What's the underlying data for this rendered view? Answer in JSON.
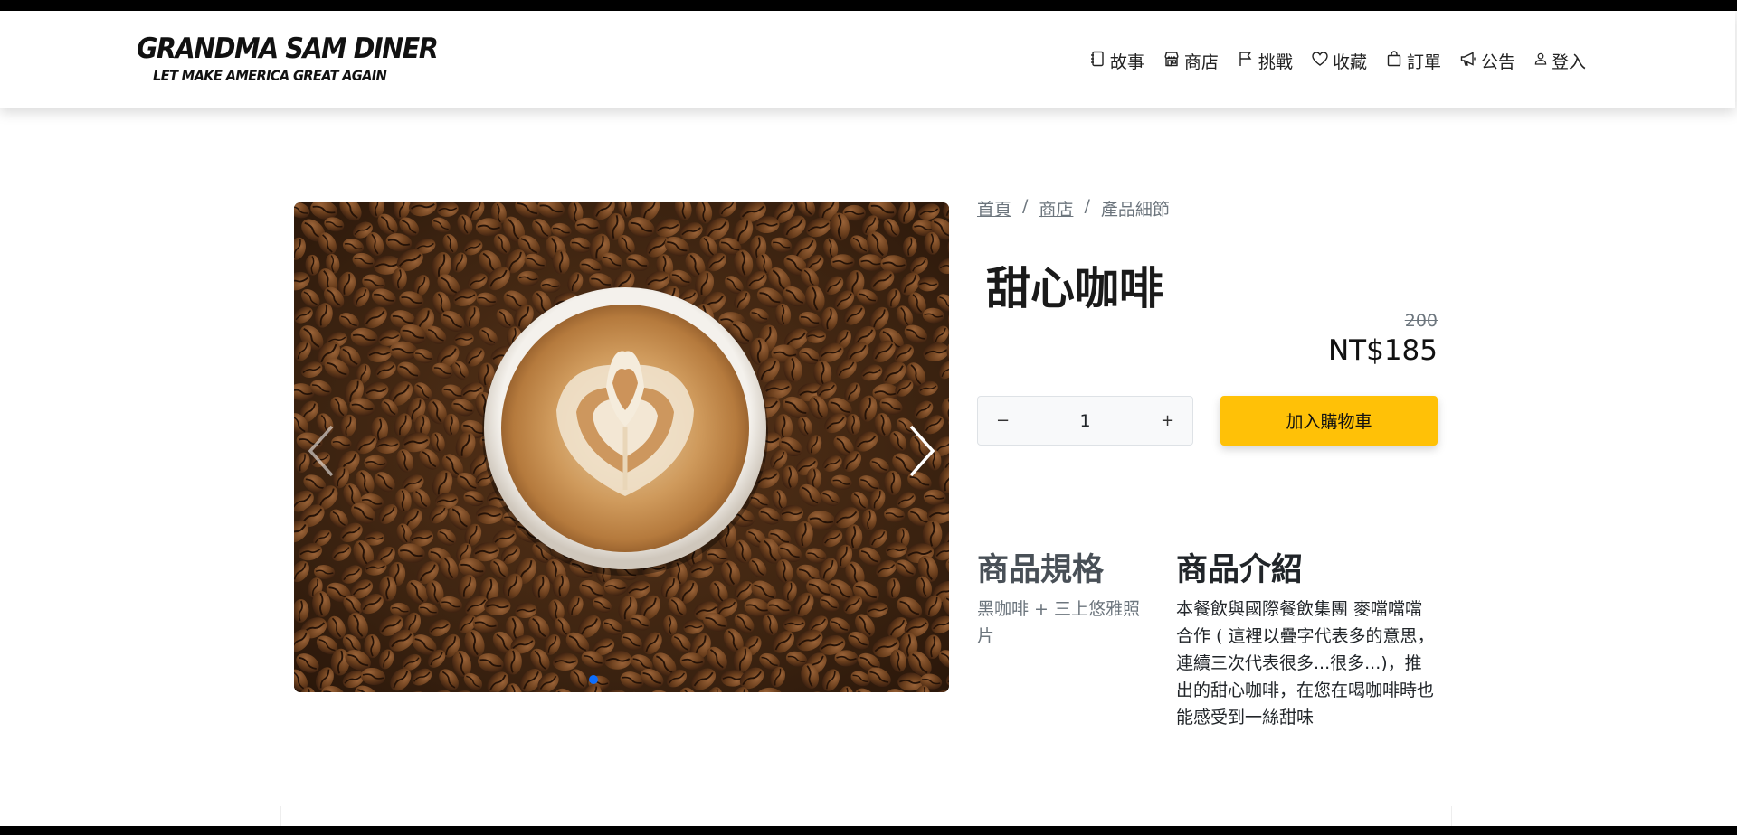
{
  "brand": {
    "title": "GRANDMA SAM DINER",
    "subtitle": "LET MAKE AMERICA GREAT AGAIN"
  },
  "nav": {
    "items": [
      {
        "label": "故事",
        "icon": "journal-icon"
      },
      {
        "label": "商店",
        "icon": "shop-icon"
      },
      {
        "label": "挑戰",
        "icon": "flag-icon"
      },
      {
        "label": "收藏",
        "icon": "heart-icon"
      },
      {
        "label": "訂單",
        "icon": "bag-icon"
      },
      {
        "label": "公告",
        "icon": "megaphone-icon"
      },
      {
        "label": "登入",
        "icon": "person-icon"
      }
    ]
  },
  "breadcrumb": {
    "home": "首頁",
    "shop": "商店",
    "current": "產品細節",
    "separator": "/"
  },
  "product": {
    "name": "甜心咖啡",
    "original_price": "200",
    "price": "NT$185",
    "quantity": "1",
    "decrease_label": "−",
    "increase_label": "+",
    "add_to_cart_label": "加入購物車"
  },
  "spec": {
    "title": "商品規格",
    "text": "黑咖啡 + 三上悠雅照片"
  },
  "intro": {
    "title": "商品介紹",
    "text": "本餐飲與國際餐飲集團 麥噹噹噹 合作 ( 這裡以疊字代表多的意思，連續三次代表很多...很多...)，推出的甜心咖啡，在您在喝咖啡時也能感受到一絲甜味"
  },
  "carousel": {
    "image": "latte-art-on-coffee-beans",
    "active_index": 1,
    "total": 1
  },
  "colors": {
    "accent": "#ffc107",
    "indicator": "#0d6efd",
    "muted": "#6c757d"
  }
}
